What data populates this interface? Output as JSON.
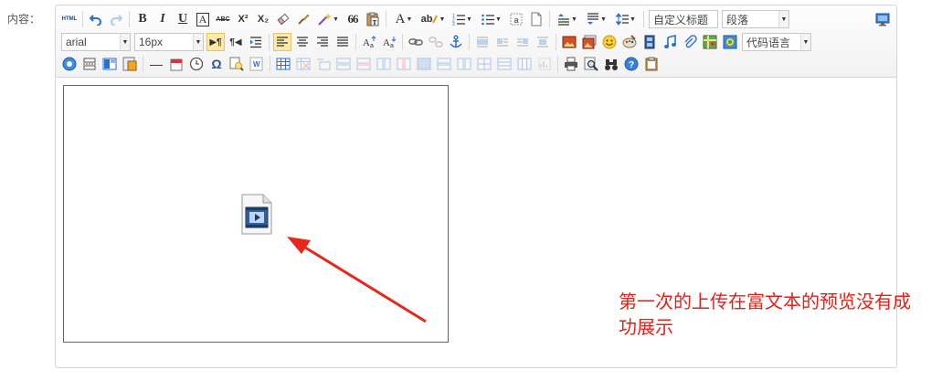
{
  "form": {
    "label": "内容："
  },
  "toolbar": {
    "row1": {
      "html": "HTML",
      "bold": "B",
      "italic": "I",
      "underline": "U",
      "border_char": "A",
      "strike": "ABC",
      "superscript": "X²",
      "subscript": "X₂",
      "quote": "66",
      "font_color": "A",
      "highlight": "ab",
      "title_select": "自定义标题",
      "paragraph_select": "段落"
    },
    "row2": {
      "font_family": "arial",
      "font_size": "16px",
      "ltr": "▶¶",
      "rtl": "¶◀",
      "code_language": "代码语言"
    },
    "row3": {
      "horizontal_rule": "—",
      "omega": "Ω",
      "help": "?"
    }
  },
  "annotation": {
    "line1": "第一次的上传在富文本的预览没有成",
    "line2": "功展示"
  },
  "colors": {
    "annotation_red": "#e0231a",
    "active_button": "#fde9a8"
  }
}
